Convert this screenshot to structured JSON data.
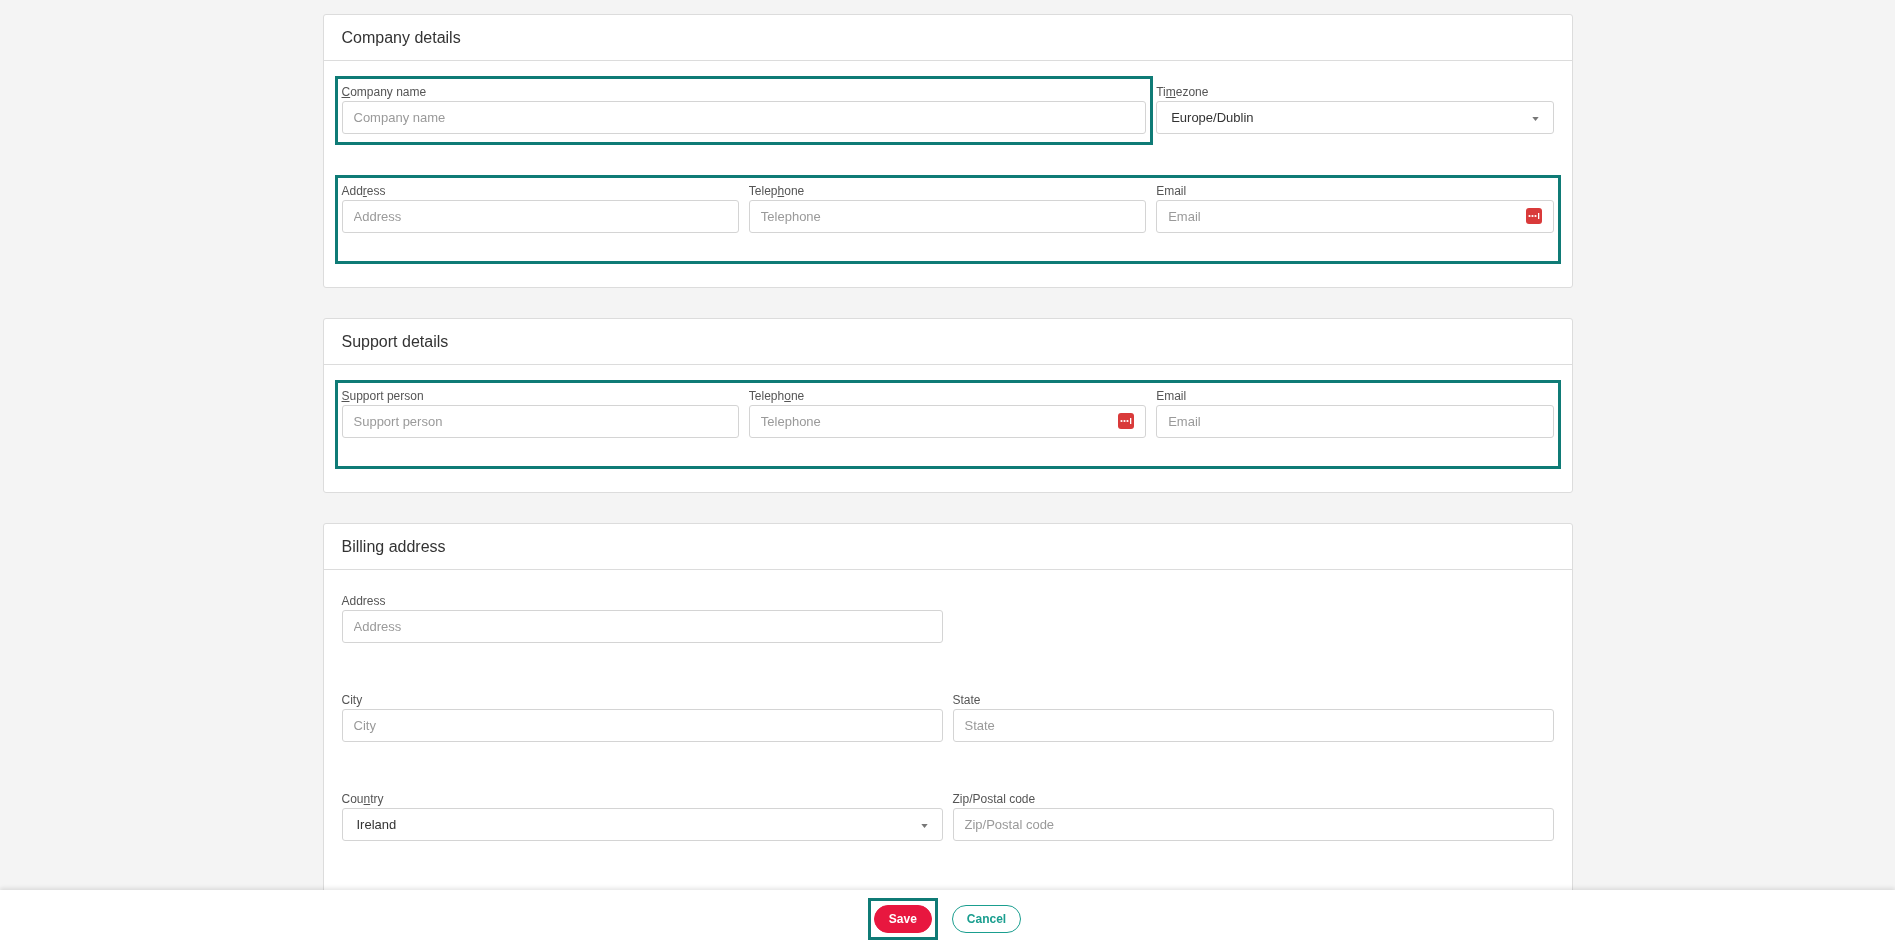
{
  "sections": [
    {
      "title": "Company details",
      "rows": [
        {
          "groups": [
            {
              "highlighted": true,
              "fields": [
                {
                  "kind": "text",
                  "label": [
                    {
                      "text": "C",
                      "underlined": true
                    },
                    {
                      "text": "ompany name",
                      "underlined": false
                    }
                  ],
                  "placeholder": "Company name",
                  "autofill_icon": false
                }
              ]
            },
            {
              "highlighted": false,
              "fields": [
                {
                  "kind": "select",
                  "label": [
                    {
                      "text": "Ti",
                      "underlined": false
                    },
                    {
                      "text": "m",
                      "underlined": true
                    },
                    {
                      "text": "ezone",
                      "underlined": false
                    }
                  ],
                  "value": "Europe/Dublin"
                }
              ]
            }
          ]
        },
        {
          "groups": [
            {
              "highlighted": true,
              "fields": [
                {
                  "kind": "text",
                  "label": [
                    {
                      "text": "Add",
                      "underlined": false
                    },
                    {
                      "text": "r",
                      "underlined": true
                    },
                    {
                      "text": "ess",
                      "underlined": false
                    }
                  ],
                  "placeholder": "Address",
                  "autofill_icon": false
                },
                {
                  "kind": "text",
                  "label": [
                    {
                      "text": "Telep",
                      "underlined": false
                    },
                    {
                      "text": "h",
                      "underlined": true
                    },
                    {
                      "text": "one",
                      "underlined": false
                    }
                  ],
                  "placeholder": "Telephone",
                  "autofill_icon": false
                },
                {
                  "kind": "text",
                  "label": [
                    {
                      "text": "Email",
                      "underlined": false
                    }
                  ],
                  "placeholder": "Email",
                  "autofill_icon": true
                }
              ]
            }
          ]
        }
      ]
    },
    {
      "title": "Support details",
      "rows": [
        {
          "groups": [
            {
              "highlighted": true,
              "fields": [
                {
                  "kind": "text",
                  "label": [
                    {
                      "text": "S",
                      "underlined": true
                    },
                    {
                      "text": "upport person",
                      "underlined": false
                    }
                  ],
                  "placeholder": "Support person",
                  "autofill_icon": false
                },
                {
                  "kind": "text",
                  "label": [
                    {
                      "text": "Teleph",
                      "underlined": false
                    },
                    {
                      "text": "o",
                      "underlined": true
                    },
                    {
                      "text": "ne",
                      "underlined": false
                    }
                  ],
                  "placeholder": "Telephone",
                  "autofill_icon": true
                },
                {
                  "kind": "text",
                  "label": [
                    {
                      "text": "Email",
                      "underlined": false
                    }
                  ],
                  "placeholder": "Email",
                  "autofill_icon": false
                }
              ]
            }
          ]
        }
      ]
    },
    {
      "title": "Billing address",
      "rows": [
        {
          "groups": [
            {
              "highlighted": false,
              "fields": [
                {
                  "kind": "text",
                  "label": [
                    {
                      "text": "Address",
                      "underlined": false
                    }
                  ],
                  "placeholder": "Address",
                  "autofill_icon": false
                }
              ]
            }
          ]
        },
        {
          "groups": [
            {
              "highlighted": false,
              "fields": [
                {
                  "kind": "text",
                  "label": [
                    {
                      "text": "City",
                      "underlined": false
                    }
                  ],
                  "placeholder": "City",
                  "autofill_icon": false
                },
                {
                  "kind": "text",
                  "label": [
                    {
                      "text": "State",
                      "underlined": false
                    }
                  ],
                  "placeholder": "State",
                  "autofill_icon": false
                }
              ]
            }
          ]
        },
        {
          "groups": [
            {
              "highlighted": false,
              "fields": [
                {
                  "kind": "select",
                  "label": [
                    {
                      "text": "Cou",
                      "underlined": false
                    },
                    {
                      "text": "n",
                      "underlined": true
                    },
                    {
                      "text": "try",
                      "underlined": false
                    }
                  ],
                  "value": "Ireland"
                },
                {
                  "kind": "text",
                  "label": [
                    {
                      "text": "Zip/Postal code",
                      "underlined": false
                    }
                  ],
                  "placeholder": "Zip/Postal code",
                  "autofill_icon": false
                }
              ]
            }
          ]
        }
      ]
    }
  ],
  "footer": {
    "buttons": [
      {
        "kind": "primary",
        "label": "Save",
        "highlighted": true
      },
      {
        "kind": "secondary",
        "label": "Cancel",
        "highlighted": false
      }
    ]
  }
}
